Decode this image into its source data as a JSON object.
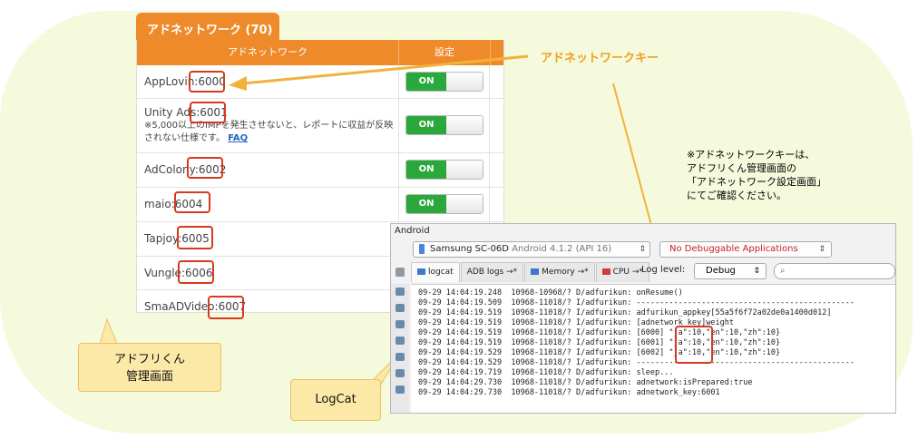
{
  "admin": {
    "tab_title": "アドネットワーク (70)",
    "header": {
      "col_network": "アドネットワーク",
      "col_setting": "設定"
    },
    "rows": [
      {
        "name": "AppLovin:6000",
        "toggle": "ON"
      },
      {
        "name": "Unity Ads:6001",
        "note": "※5,000以上のIMPを発生させないと、レポートに収益が反映されない仕様です。",
        "link": "FAQ",
        "toggle": "ON"
      },
      {
        "name": "AdColony:6002",
        "toggle": "ON"
      },
      {
        "name": "maio:6004",
        "toggle": "ON"
      },
      {
        "name": "Tapjoy:6005"
      },
      {
        "name": "Vungle:6006"
      },
      {
        "name": "SmaADVideo:6007"
      }
    ]
  },
  "callouts": {
    "network_key_label": "アドネットワークキー",
    "note_lines": [
      "※アドネットワークキーは、",
      "アドフリくん管理画面の",
      "「アドネットワーク設定画面」",
      "にてご確認ください。"
    ],
    "admin_bubble": [
      "アドフリくん",
      "管理画面"
    ],
    "logcat_bubble": "LogCat"
  },
  "android": {
    "title": "Android",
    "device": "Samsung SC-06D",
    "device_sub": "Android 4.1.2 (API 16)",
    "app_select": "No Debuggable Applications",
    "tabs": [
      "logcat",
      "ADB logs",
      "Memory",
      "CPU"
    ],
    "loglevel_label": "Log level:",
    "loglevel_value": "Debug",
    "search_icon": "search-icon",
    "lines": [
      "09-29 14:04:19.248  10968-10968/? D/adfurikun: onResume()",
      "09-29 14:04:19.509  10968-11018/? I/adfurikun: -----------------------------------------------",
      "09-29 14:04:19.519  10968-11018/? I/adfurikun: adfurikun_appkey[55a5f6f72a02de0a1400d012]",
      "09-29 14:04:19.519  10968-11018/? I/adfurikun: [adnetwork_key]weight",
      "09-29 14:04:19.519  10968-11018/? I/adfurikun: [6000] \"ja\":10,\"en\":10,\"zh\":10}",
      "09-29 14:04:19.519  10968-11018/? I/adfurikun: [6001] \"ja\":10,\"en\":10,\"zh\":10}",
      "09-29 14:04:19.529  10968-11018/? I/adfurikun: [6002] \"ja\":10,\"en\":10,\"zh\":10}",
      "09-29 14:04:19.529  10968-11018/? I/adfurikun: -----------------------------------------------",
      "09-29 14:04:19.719  10968-11018/? D/adfurikun: sleep...",
      "09-29 14:04:29.730  10968-11018/? D/adfurikun: adnetwork:isPrepared:true",
      "09-29 14:04:29.730  10968-11018/? D/adfurikun: adnetwork_key:6001"
    ]
  },
  "colors": {
    "orange": "#ef8a2a",
    "callout_orange": "#f0a020",
    "toggle_green": "#2aa83b",
    "highlight_red": "#d63a1e",
    "bubble_yellow": "#fde9a7",
    "background": "#f5fadd"
  }
}
